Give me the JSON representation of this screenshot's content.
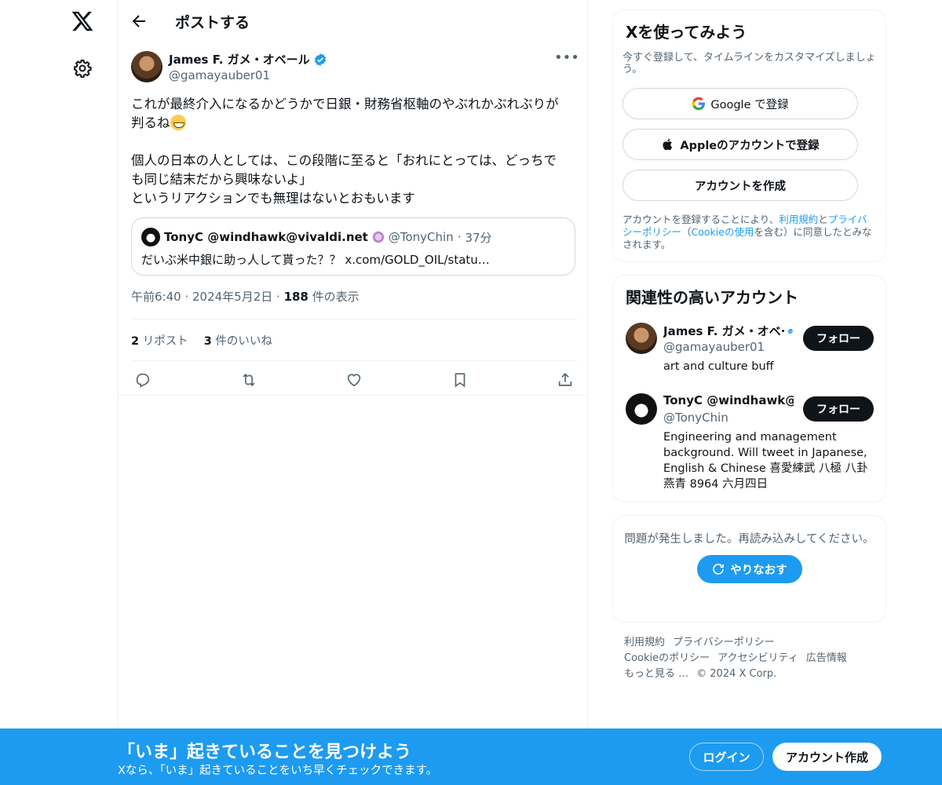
{
  "header": {
    "title": "ポストする"
  },
  "tweet": {
    "author_name": "James F. ガメ・オベール",
    "author_handle": "@gamayauber01",
    "text_line1": "これが最終介入になるかどうかで日銀・財務省枢軸のやぶれかぶれぶりが",
    "text_line2": "判るね",
    "text_rest": "\n個人の日本の人としては、この段階に至ると「おれにとっては、どっちで\nも同じ結末だから興味ないよ」\nというリアクションでも無理はないとおもいます",
    "quote": {
      "name": "TonyC @windhawk@vivaldi.net",
      "handle": "@TonyChin",
      "dot": "·",
      "time": "37分",
      "text": "だいぶ米中銀に助っ人して貰った？？ x.com/GOLD_OIL/statu…"
    },
    "meta_time": "午前6:40 · 2024年5月2日 · ",
    "meta_views": "188",
    "meta_views_label": " 件の表示",
    "reposts": "2",
    "reposts_label": " リポスト",
    "likes": "3",
    "likes_label": " 件のいいね"
  },
  "signup": {
    "title": "Xを使ってみよう",
    "subtitle": "今すぐ登録して、タイムラインをカスタマイズしましょう。",
    "google": "Google で登録",
    "apple": "Appleのアカウントで登録",
    "create": "アカウントを作成",
    "legal_1": "アカウントを登録することにより、",
    "legal_terms": "利用規約",
    "legal_2": "と",
    "legal_privacy": "プライバシーポリシー",
    "legal_3": "（",
    "legal_cookie": "Cookieの使用",
    "legal_4": "を含む）に同意したとみなされます。"
  },
  "related": {
    "title": "関連性の高いアカウント",
    "accounts": [
      {
        "name": "James F. ガメ・オベ·",
        "handle": "@gamayauber01",
        "bio": "art and culture buff",
        "follow": "フォロー"
      },
      {
        "name": "TonyC @windhawk@v",
        "handle": "@TonyChin",
        "bio": "Engineering and management background. Will tweet in Japanese, English & Chinese 喜愛練武 八極 八卦 燕青 8964 六月四日",
        "follow": "フォロー"
      }
    ]
  },
  "error": {
    "message": "問題が発生しました。再読み込みしてください。",
    "retry": "やりなおす"
  },
  "footer": {
    "terms": "利用規約",
    "privacy": "プライバシーポリシー",
    "cookie": "Cookieのポリシー",
    "accessibility": "アクセシビリティ",
    "ads": "広告情報",
    "more": "もっと見る …",
    "copyright": "© 2024 X Corp."
  },
  "bottombar": {
    "title": "「いま」起きていることを見つけよう",
    "subtitle": "Xなら、「いま」起きていることをいち早くチェックできます。",
    "login": "ログイン",
    "signup": "アカウント作成"
  },
  "colors": {
    "accent": "#1d9bf0",
    "text": "#0f1419",
    "muted": "#536471"
  }
}
